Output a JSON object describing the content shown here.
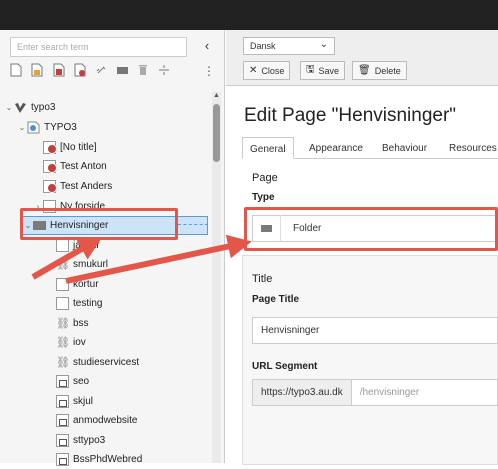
{
  "left": {
    "search_placeholder": "Enter search term",
    "collapse_icon": "chevron-left-icon",
    "toolbar_icons": [
      "new-page-icon",
      "page-icon",
      "page-add-icon",
      "page-add-red-icon",
      "link-icon",
      "folder-icon",
      "trash-icon",
      "divider-icon"
    ],
    "more_icon": "more-vertical-icon",
    "tree": [
      {
        "label": "typo3",
        "icon": "typo3-icon"
      },
      {
        "label": "TYPO3",
        "icon": "site-icon"
      },
      {
        "label": "[No title]",
        "icon": "page-hidden-icon"
      },
      {
        "label": "Test Anton",
        "icon": "page-hidden-icon"
      },
      {
        "label": "Test Anders",
        "icon": "page-hidden-icon"
      },
      {
        "label": "Ny forside",
        "icon": "page-icon"
      },
      {
        "label": "Henvisninger",
        "icon": "folder-icon"
      },
      {
        "label": "jasvar",
        "icon": "page-icon"
      },
      {
        "label": "smukurl",
        "icon": "link-icon"
      },
      {
        "label": "kortur",
        "icon": "page-icon"
      },
      {
        "label": "testing",
        "icon": "page-icon"
      },
      {
        "label": "bss",
        "icon": "link-icon"
      },
      {
        "label": "iov",
        "icon": "link-icon"
      },
      {
        "label": "studieservicest",
        "icon": "link-icon"
      },
      {
        "label": "seo",
        "icon": "page-external-icon"
      },
      {
        "label": "skjul",
        "icon": "page-external-icon"
      },
      {
        "label": "anmodwebsite",
        "icon": "page-external-icon"
      },
      {
        "label": "sttypo3",
        "icon": "page-external-icon"
      },
      {
        "label": "BssPhdWebred",
        "icon": "page-external-icon"
      }
    ]
  },
  "header": {
    "language": "Dansk",
    "close_label": "Close",
    "save_label": "Save",
    "delete_label": "Delete"
  },
  "main": {
    "title": "Edit Page \"Henvisninger\"",
    "tabs": [
      "General",
      "Appearance",
      "Behaviour",
      "Resources"
    ],
    "page_section": "Page",
    "type_label": "Type",
    "type_value": "Folder",
    "title_section": "Title",
    "page_title_label": "Page Title",
    "page_title_value": "Henvisninger",
    "url_label": "URL Segment",
    "url_prefix": "https://typo3.au.dk",
    "url_value": "/henvisninger"
  },
  "colors": {
    "accent": "#e4554a",
    "selection": "#cde3f7",
    "topbar": "#212121"
  }
}
